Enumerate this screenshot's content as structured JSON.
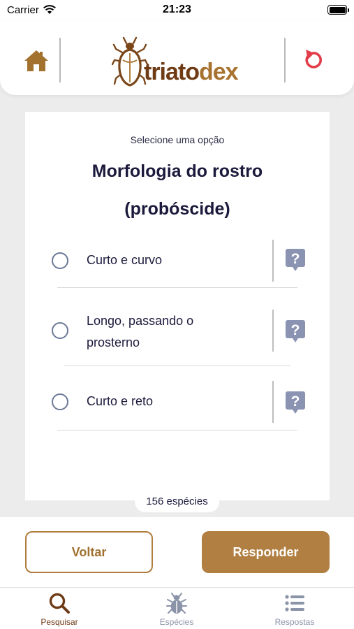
{
  "status_bar": {
    "carrier": "Carrier",
    "time": "21:23"
  },
  "header": {
    "logo": {
      "text_part1": "triato",
      "text_part2": "dex"
    },
    "icons": {
      "home": "home-icon",
      "refresh": "refresh-icon"
    }
  },
  "question": {
    "prompt": "Selecione uma opção",
    "title": "Morfologia do rostro (probóscide)",
    "options": [
      {
        "label": "Curto e curvo",
        "selected": false
      },
      {
        "label": "Longo, passando o prosterno",
        "selected": false
      },
      {
        "label": "Curto e reto",
        "selected": false
      }
    ]
  },
  "species_count": "156 espécies",
  "buttons": {
    "back": "Voltar",
    "answer": "Responder"
  },
  "tabs": [
    {
      "label": "Pesquisar",
      "icon": "search-icon",
      "active": true
    },
    {
      "label": "Espécies",
      "icon": "bug-icon",
      "active": false
    },
    {
      "label": "Respostas",
      "icon": "list-icon",
      "active": false
    }
  ],
  "colors": {
    "brand_dark": "#6e3b15",
    "brand": "#b07f41",
    "accent_red": "#e23d4a",
    "text_dark": "#1c1a3c",
    "icon_muted": "#8a93a8"
  }
}
